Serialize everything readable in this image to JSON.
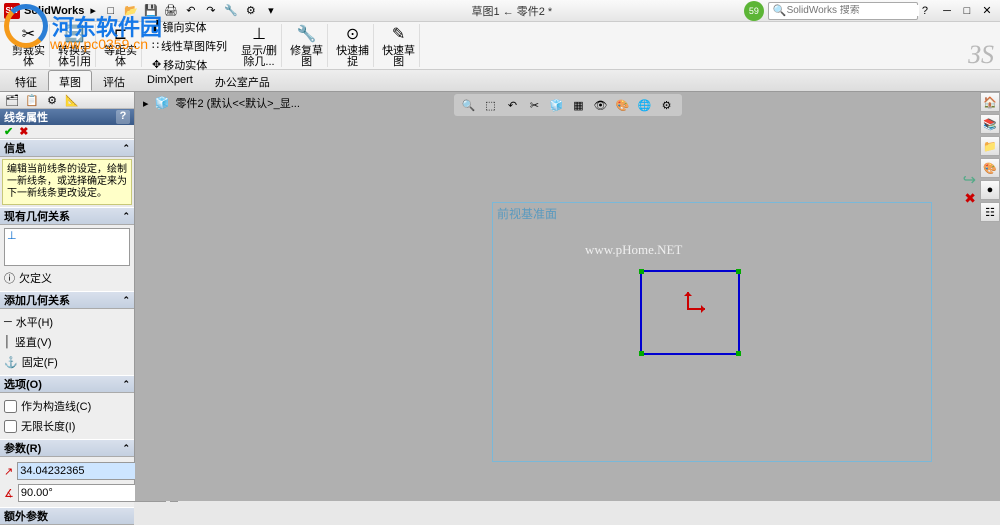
{
  "title_bar": {
    "app": "SolidWorks",
    "doc": "草图1 ← 零件2 *",
    "search_placeholder": "SolidWorks 搜索",
    "badge": "59"
  },
  "qat": {
    "new": "□",
    "open": "📂",
    "save": "💾",
    "print": "🖨",
    "undo": "↶",
    "redo": "↷",
    "rebuild": "🔧",
    "options": "⚙",
    "more": "▾"
  },
  "ribbon": {
    "mirror": "镜向实体",
    "linear": "线性草图阵列",
    "move": "移动实体",
    "trim": {
      "l1": "剪裁实",
      "l2": "体"
    },
    "convert": {
      "l1": "转换实",
      "l2": "体引用"
    },
    "offset": {
      "l1": "等距实",
      "l2": "体"
    },
    "display": {
      "l1": "显示/删",
      "l2": "除几..."
    },
    "repair": {
      "l1": "修复草",
      "l2": "图"
    },
    "quick": {
      "l1": "快速捕",
      "l2": "捉"
    },
    "rapid": {
      "l1": "快速草",
      "l2": "图"
    }
  },
  "tabs": [
    "特征",
    "草图",
    "评估",
    "DimXpert",
    "办公室产品"
  ],
  "active_tab": 1,
  "breadcrumb": "零件2 (默认<<默认>_显...",
  "prop": {
    "title": "线条属性",
    "info_head": "信息",
    "info_text": "编辑当前线条的设定，绘制一新线条，或选择确定来为下一新线条更改设定。",
    "existing_head": "现有几何关系",
    "none_def": "欠定义",
    "add_head": "添加几何关系",
    "horiz": "水平(H)",
    "vert": "竖直(V)",
    "fix": "固定(F)",
    "options_head": "选项(O)",
    "construction": "作为构造线(C)",
    "infinite": "无限长度(I)",
    "params_head": "参数(R)",
    "length": "34.04232365",
    "angle": "90.00°",
    "last_head": "额外参数"
  },
  "plane_label": "前视基准面",
  "watermark": "www.pHome.NET",
  "overlay": {
    "brand": "河东软件园",
    "url": "www.pc0359.cn"
  }
}
